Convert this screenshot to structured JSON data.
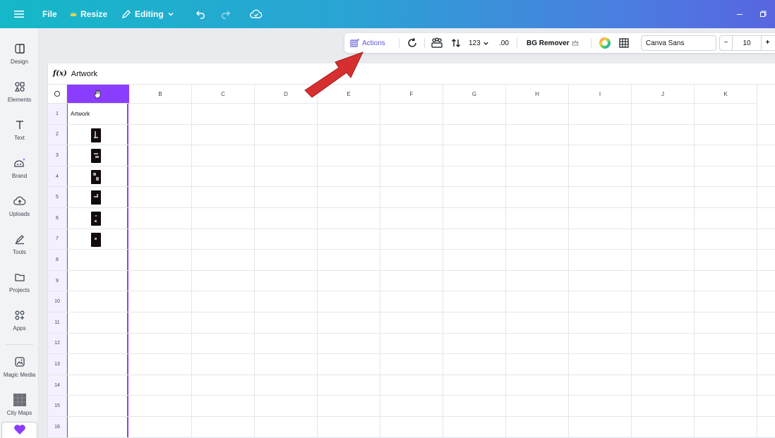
{
  "topbar": {
    "file_label": "File",
    "resize_label": "Resize",
    "editing_label": "Editing"
  },
  "sidebar": {
    "items": [
      {
        "label": "Design",
        "icon": "design-icon"
      },
      {
        "label": "Elements",
        "icon": "elements-icon"
      },
      {
        "label": "Text",
        "icon": "text-icon"
      },
      {
        "label": "Brand",
        "icon": "brand-icon"
      },
      {
        "label": "Uploads",
        "icon": "uploads-icon"
      },
      {
        "label": "Tools",
        "icon": "tools-icon"
      },
      {
        "label": "Projects",
        "icon": "projects-icon"
      },
      {
        "label": "Apps",
        "icon": "apps-icon"
      },
      {
        "label": "Magic Media",
        "icon": "magic-media-icon"
      },
      {
        "label": "City Maps",
        "icon": "city-maps-icon"
      }
    ]
  },
  "toolbar": {
    "actions_label": "Actions",
    "number_format_label": "123",
    "decimal_label": ".00",
    "bg_remover_label": "BG Remover",
    "font_name": "Canva Sans",
    "minus_label": "−",
    "font_size": "10",
    "plus_label": "+"
  },
  "formula_bar": {
    "fx_label": "f(x)",
    "value": "Artwork"
  },
  "sheet": {
    "columns": [
      "B",
      "C",
      "D",
      "E",
      "F",
      "G",
      "H",
      "I",
      "J",
      "K"
    ],
    "rows": [
      "1",
      "2",
      "3",
      "4",
      "5",
      "6",
      "7",
      "8",
      "9",
      "10",
      "11",
      "12",
      "13",
      "14",
      "15",
      "16"
    ],
    "cell_A1": "Artwork",
    "image_rows": 6
  },
  "colors": {
    "accent": "#8b3dff",
    "annotation_arrow": "#d62f2f"
  }
}
